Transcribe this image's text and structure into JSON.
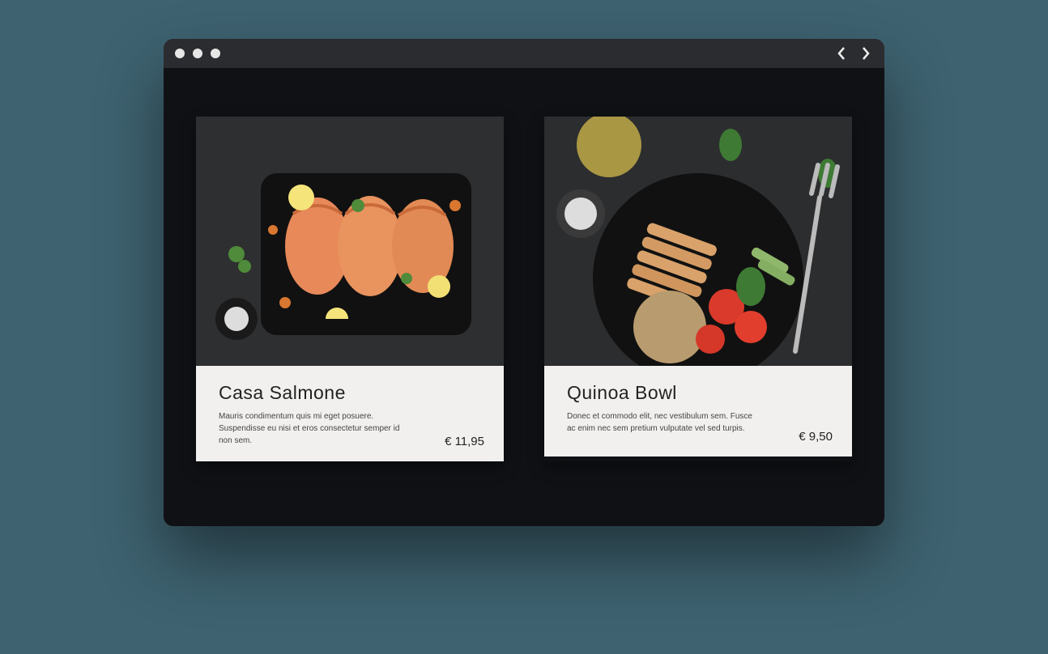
{
  "cards": [
    {
      "title": "Casa Salmone",
      "description": "Mauris condimentum quis mi eget posuere. Suspendisse eu nisi et eros consectetur semper id non sem.",
      "price": "€ 11,95"
    },
    {
      "title": "Quinoa Bowl",
      "description": "Donec et commodo elit, nec vestibulum sem. Fusce ac enim nec sem pretium vulputate vel sed turpis.",
      "price": "€ 9,50"
    }
  ]
}
